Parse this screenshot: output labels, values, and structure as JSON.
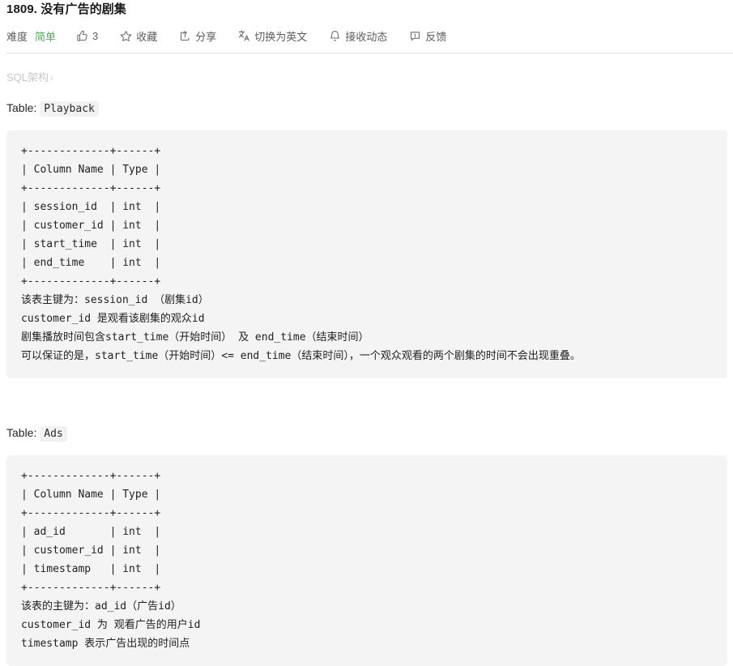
{
  "header": {
    "title": "1809. 没有广告的剧集",
    "toolbar": {
      "difficulty_label": "难度",
      "difficulty_value": "简单",
      "like_count": "3",
      "favorite_label": "收藏",
      "share_label": "分享",
      "translate_label": "切换为英文",
      "subscribe_label": "接收动态",
      "feedback_label": "反馈"
    },
    "icons": {
      "like": "thumbs-up-icon",
      "favorite": "star-icon",
      "share": "share-icon",
      "translate": "translate-icon",
      "subscribe": "bell-icon",
      "feedback": "feedback-icon"
    },
    "accent_colors": {
      "easy_green": "#4caf50",
      "text": "#5c5c5c",
      "divider": "#e0e0e0"
    }
  },
  "breadcrumb": {
    "label": "SQL架构",
    "separator": "›"
  },
  "sections": [
    {
      "caption_prefix": "Table:",
      "table_name": "Playback",
      "code": "+-------------+------+\n| Column Name | Type |\n+-------------+------+\n| session_id  | int  |\n| customer_id | int  |\n| start_time  | int  |\n| end_time    | int  |\n+-------------+------+\n该表主键为：session_id （剧集id）\ncustomer_id 是观看该剧集的观众id\n剧集播放时间包含start_time（开始时间） 及 end_time（结束时间）\n可以保证的是，start_time（开始时间）<= end_time（结束时间），一个观众观看的两个剧集的时间不会出现重叠。"
    },
    {
      "caption_prefix": "Table:",
      "table_name": "Ads",
      "code": "+-------------+------+\n| Column Name | Type |\n+-------------+------+\n| ad_id       | int  |\n| customer_id | int  |\n| timestamp   | int  |\n+-------------+------+\n该表的主键为：ad_id（广告id）\ncustomer_id 为 观看广告的用户id\ntimestamp 表示广告出现的时间点"
    }
  ]
}
